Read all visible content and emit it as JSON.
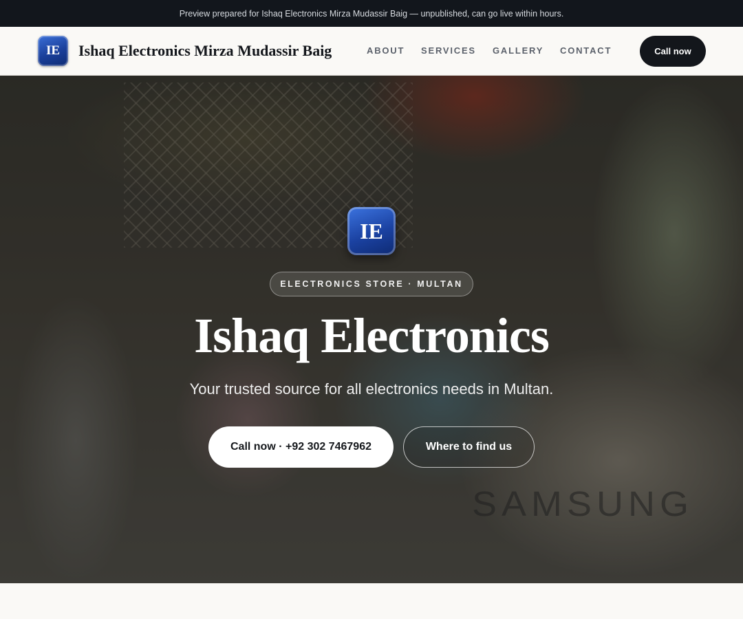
{
  "preview_bar": {
    "text": "Preview prepared for Ishaq Electronics Mirza Mudassir Baig — unpublished, can go live within hours."
  },
  "header": {
    "logo_initials": "IE",
    "brand_name": "Ishaq Electronics Mirza Mudassir Baig",
    "nav": [
      "ABOUT",
      "SERVICES",
      "GALLERY",
      "CONTACT"
    ],
    "cta_label": "Call now"
  },
  "hero": {
    "logo_initials": "IE",
    "eyebrow": "ELECTRONICS STORE · MULTAN",
    "title": "Ishaq Electronics",
    "subtitle": "Your trusted source for all electronics needs in Multan.",
    "primary_button": "Call now · +92 302 7467962",
    "secondary_button": "Where to find us",
    "background_text": "SAMSUNG"
  },
  "colors": {
    "preview_bar_bg": "#12161c",
    "header_bg": "#faf9f6",
    "accent_blue": "#1b42a2",
    "cta_dark": "#13161b"
  }
}
